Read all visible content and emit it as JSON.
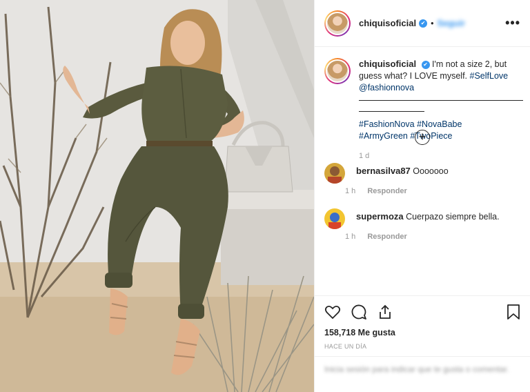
{
  "header": {
    "username": "chiquisoficial",
    "verified_icon": "✔",
    "separator": "•",
    "follow_label": "Seguir",
    "more_icon": "•••"
  },
  "caption": {
    "username": "chiquisoficial",
    "text": "I'm not a size 2, but guess what? I LOVE myself.",
    "hashtags_line1": [
      "#SelfLove",
      "@fashionnova"
    ],
    "hashtags_line2": [
      "#FashionNova",
      "#NovaBabe",
      "#ArmyGreen",
      "#TwoPiece"
    ],
    "time": "1 d"
  },
  "load_more_icon": "+",
  "comments": [
    {
      "username": "bernasilva87",
      "text": "Ooooooo",
      "time": "1 h",
      "reply_label": "Responder"
    },
    {
      "username": "supermoza",
      "text": "Cuerpazo siempre bella.",
      "time": "1 h",
      "reply_label": "Responder"
    }
  ],
  "likes": {
    "count_text": "158,718 Me gusta"
  },
  "posted_ago": "HACE UN DÍA",
  "add_comment": {
    "placeholder": "Inicia sesión para indicar que te gusta o comentar."
  },
  "colors": {
    "link": "#003569",
    "verified": "#3897f0",
    "muted": "#999999"
  }
}
